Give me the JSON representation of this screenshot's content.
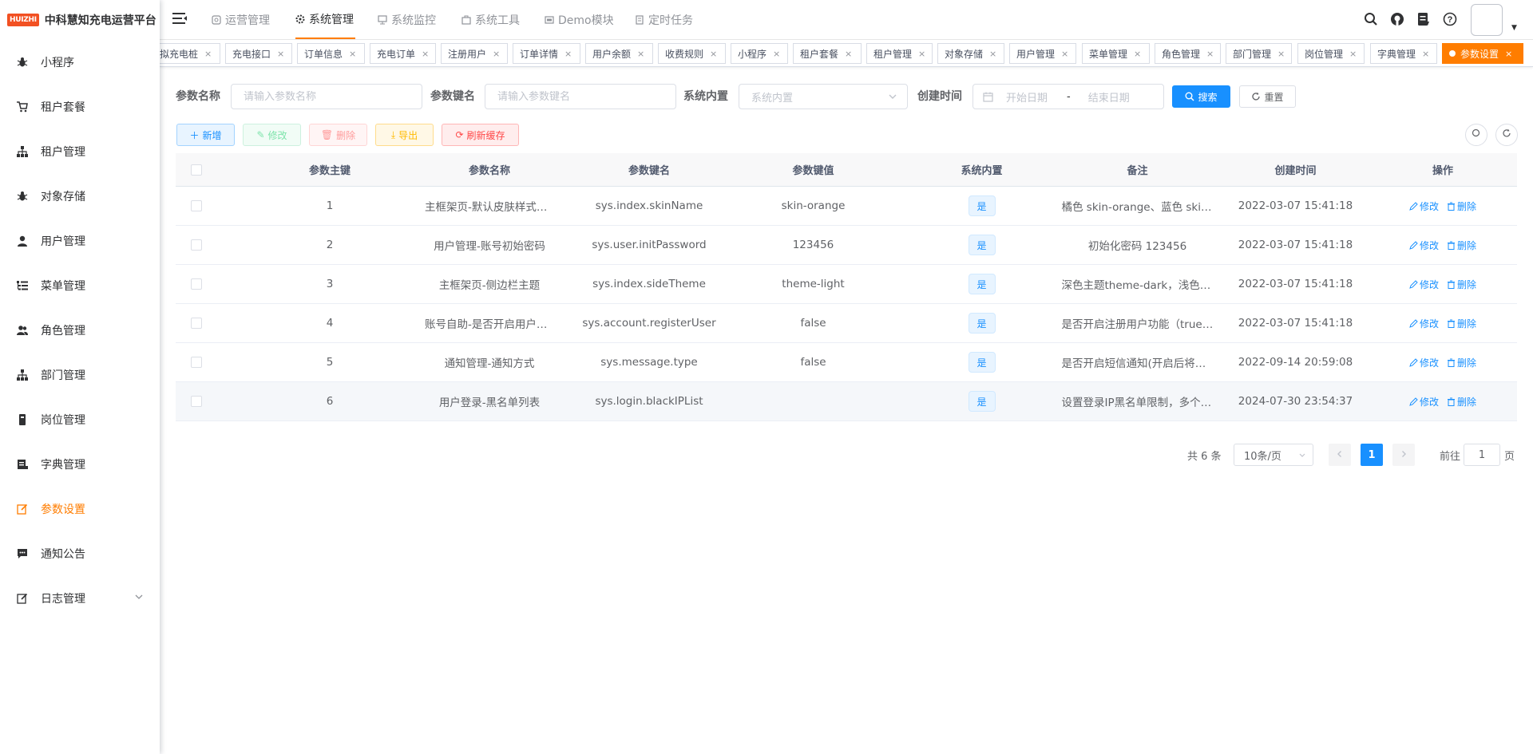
{
  "logo": {
    "badge": "HUIZHI",
    "title": "中科慧知充电运营平台"
  },
  "sidebar": {
    "items": [
      {
        "label": "小程序",
        "icon": "bug-icon"
      },
      {
        "label": "租户套餐",
        "icon": "cart-icon"
      },
      {
        "label": "租户管理",
        "icon": "tree-icon"
      },
      {
        "label": "对象存储",
        "icon": "bug-icon"
      },
      {
        "label": "用户管理",
        "icon": "user-icon"
      },
      {
        "label": "菜单管理",
        "icon": "tree-table-icon"
      },
      {
        "label": "角色管理",
        "icon": "peoples-icon"
      },
      {
        "label": "部门管理",
        "icon": "tree-icon"
      },
      {
        "label": "岗位管理",
        "icon": "post-icon"
      },
      {
        "label": "字典管理",
        "icon": "dict-icon"
      },
      {
        "label": "参数设置",
        "icon": "edit-icon",
        "active": true
      },
      {
        "label": "通知公告",
        "icon": "message-icon"
      },
      {
        "label": "日志管理",
        "icon": "log-icon",
        "has_arrow": true
      }
    ]
  },
  "topnav": {
    "tabs": [
      {
        "label": "运营管理",
        "icon": "box-icon"
      },
      {
        "label": "系统管理",
        "icon": "gear-icon",
        "active": true
      },
      {
        "label": "系统监控",
        "icon": "monitor-icon"
      },
      {
        "label": "系统工具",
        "icon": "toolbox-icon"
      },
      {
        "label": "Demo模块",
        "icon": "code-icon"
      },
      {
        "label": "定时任务",
        "icon": "doc-icon"
      }
    ]
  },
  "tags": [
    {
      "label": "拟充电桩"
    },
    {
      "label": "充电接口"
    },
    {
      "label": "订单信息"
    },
    {
      "label": "充电订单"
    },
    {
      "label": "注册用户"
    },
    {
      "label": "订单详情"
    },
    {
      "label": "用户余额"
    },
    {
      "label": "收费规则"
    },
    {
      "label": "小程序"
    },
    {
      "label": "租户套餐"
    },
    {
      "label": "租户管理"
    },
    {
      "label": "对象存储"
    },
    {
      "label": "用户管理"
    },
    {
      "label": "菜单管理"
    },
    {
      "label": "角色管理"
    },
    {
      "label": "部门管理"
    },
    {
      "label": "岗位管理"
    },
    {
      "label": "字典管理"
    },
    {
      "label": "参数设置",
      "active": true
    }
  ],
  "search": {
    "config_name_label": "参数名称",
    "config_name_placeholder": "请输入参数名称",
    "config_key_label": "参数键名",
    "config_key_placeholder": "请输入参数键名",
    "config_type_label": "系统内置",
    "config_type_placeholder": "系统内置",
    "date_label": "创建时间",
    "start_placeholder": "开始日期",
    "date_separator": "-",
    "end_placeholder": "结束日期",
    "search_button": "搜索",
    "reset_button": "重置"
  },
  "toolbar": {
    "add": "新增",
    "edit": "修改",
    "delete": "删除",
    "export": "导出",
    "refresh_cache": "刷新缓存"
  },
  "table": {
    "headers": [
      "参数主键",
      "参数名称",
      "参数键名",
      "参数键值",
      "系统内置",
      "备注",
      "创建时间",
      "操作"
    ],
    "rows": [
      {
        "id": "1",
        "name": "主框架页-默认皮肤样式名称",
        "key": "sys.index.skinName",
        "value": "skin-orange",
        "builtin": "是",
        "remark": "橘色 skin-orange、蓝色 skin-blue",
        "created": "2022-03-07 15:41:18"
      },
      {
        "id": "2",
        "name": "用户管理-账号初始密码",
        "key": "sys.user.initPassword",
        "value": "123456",
        "builtin": "是",
        "remark": "初始化密码 123456",
        "created": "2022-03-07 15:41:18"
      },
      {
        "id": "3",
        "name": "主框架页-侧边栏主题",
        "key": "sys.index.sideTheme",
        "value": "theme-light",
        "builtin": "是",
        "remark": "深色主题theme-dark，浅色主题",
        "created": "2022-03-07 15:41:18"
      },
      {
        "id": "4",
        "name": "账号自助-是否开启用户注册功能",
        "key": "sys.account.registerUser",
        "value": "false",
        "builtin": "是",
        "remark": "是否开启注册用户功能（true开启）",
        "created": "2022-03-07 15:41:18"
      },
      {
        "id": "5",
        "name": "通知管理-通知方式",
        "key": "sys.message.type",
        "value": "false",
        "builtin": "是",
        "remark": "是否开启短信通知(开启后将发送)",
        "created": "2022-09-14 20:59:08"
      },
      {
        "id": "6",
        "name": "用户登录-黑名单列表",
        "key": "sys.login.blackIPList",
        "value": "",
        "builtin": "是",
        "remark": "设置登录IP黑名单限制，多个匹配",
        "created": "2024-07-30 23:54:37"
      }
    ],
    "action_edit": "修改",
    "action_delete": "删除"
  },
  "pagination": {
    "total_text": "共 6 条",
    "page_size": "10条/页",
    "current_page": "1",
    "goto_label": "前往",
    "goto_value": "1",
    "page_suffix": "页"
  },
  "colors": {
    "accent": "#ff7d00",
    "primary": "#1890ff"
  }
}
